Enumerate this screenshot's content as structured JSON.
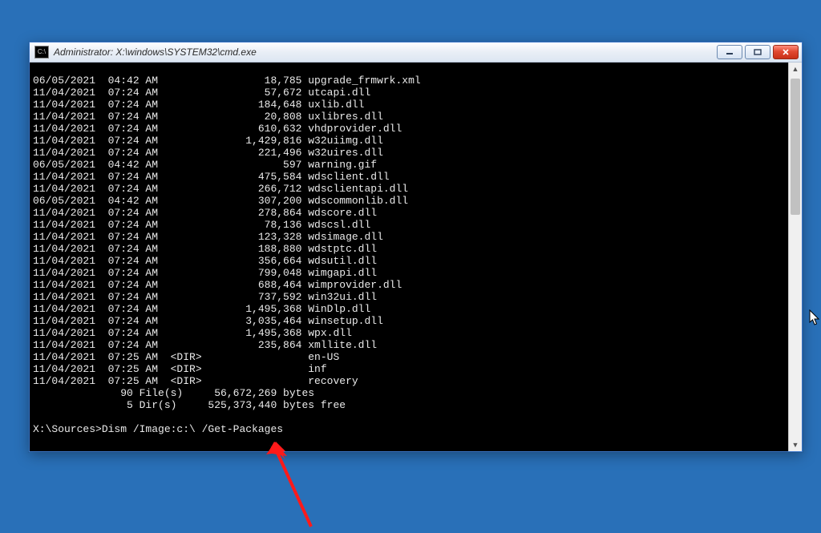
{
  "window": {
    "icon_glyph": "C:\\",
    "title": "Administrator: X:\\windows\\SYSTEM32\\cmd.exe"
  },
  "listing": [
    {
      "date": "06/05/2021",
      "time": "04:42 AM",
      "dir": "",
      "size": "18,785",
      "name": "upgrade_frmwrk.xml"
    },
    {
      "date": "11/04/2021",
      "time": "07:24 AM",
      "dir": "",
      "size": "57,672",
      "name": "utcapi.dll"
    },
    {
      "date": "11/04/2021",
      "time": "07:24 AM",
      "dir": "",
      "size": "184,648",
      "name": "uxlib.dll"
    },
    {
      "date": "11/04/2021",
      "time": "07:24 AM",
      "dir": "",
      "size": "20,808",
      "name": "uxlibres.dll"
    },
    {
      "date": "11/04/2021",
      "time": "07:24 AM",
      "dir": "",
      "size": "610,632",
      "name": "vhdprovider.dll"
    },
    {
      "date": "11/04/2021",
      "time": "07:24 AM",
      "dir": "",
      "size": "1,429,816",
      "name": "w32uiimg.dll"
    },
    {
      "date": "11/04/2021",
      "time": "07:24 AM",
      "dir": "",
      "size": "221,496",
      "name": "w32uires.dll"
    },
    {
      "date": "06/05/2021",
      "time": "04:42 AM",
      "dir": "",
      "size": "597",
      "name": "warning.gif"
    },
    {
      "date": "11/04/2021",
      "time": "07:24 AM",
      "dir": "",
      "size": "475,584",
      "name": "wdsclient.dll"
    },
    {
      "date": "11/04/2021",
      "time": "07:24 AM",
      "dir": "",
      "size": "266,712",
      "name": "wdsclientapi.dll"
    },
    {
      "date": "06/05/2021",
      "time": "04:42 AM",
      "dir": "",
      "size": "307,200",
      "name": "wdscommonlib.dll"
    },
    {
      "date": "11/04/2021",
      "time": "07:24 AM",
      "dir": "",
      "size": "278,864",
      "name": "wdscore.dll"
    },
    {
      "date": "11/04/2021",
      "time": "07:24 AM",
      "dir": "",
      "size": "78,136",
      "name": "wdscsl.dll"
    },
    {
      "date": "11/04/2021",
      "time": "07:24 AM",
      "dir": "",
      "size": "123,328",
      "name": "wdsimage.dll"
    },
    {
      "date": "11/04/2021",
      "time": "07:24 AM",
      "dir": "",
      "size": "188,880",
      "name": "wdstptc.dll"
    },
    {
      "date": "11/04/2021",
      "time": "07:24 AM",
      "dir": "",
      "size": "356,664",
      "name": "wdsutil.dll"
    },
    {
      "date": "11/04/2021",
      "time": "07:24 AM",
      "dir": "",
      "size": "799,048",
      "name": "wimgapi.dll"
    },
    {
      "date": "11/04/2021",
      "time": "07:24 AM",
      "dir": "",
      "size": "688,464",
      "name": "wimprovider.dll"
    },
    {
      "date": "11/04/2021",
      "time": "07:24 AM",
      "dir": "",
      "size": "737,592",
      "name": "win32ui.dll"
    },
    {
      "date": "11/04/2021",
      "time": "07:24 AM",
      "dir": "",
      "size": "1,495,368",
      "name": "WinDlp.dll"
    },
    {
      "date": "11/04/2021",
      "time": "07:24 AM",
      "dir": "",
      "size": "3,035,464",
      "name": "winsetup.dll"
    },
    {
      "date": "11/04/2021",
      "time": "07:24 AM",
      "dir": "",
      "size": "1,495,368",
      "name": "wpx.dll"
    },
    {
      "date": "11/04/2021",
      "time": "07:24 AM",
      "dir": "",
      "size": "235,864",
      "name": "xmllite.dll"
    },
    {
      "date": "11/04/2021",
      "time": "07:25 AM",
      "dir": "<DIR>",
      "size": "",
      "name": "en-US"
    },
    {
      "date": "11/04/2021",
      "time": "07:25 AM",
      "dir": "<DIR>",
      "size": "",
      "name": "inf"
    },
    {
      "date": "11/04/2021",
      "time": "07:25 AM",
      "dir": "<DIR>",
      "size": "",
      "name": "recovery"
    }
  ],
  "summary": {
    "files_count": "90",
    "files_label": "File(s)",
    "files_bytes": "56,672,269",
    "files_unit": "bytes",
    "dirs_count": "5",
    "dirs_label": "Dir(s)",
    "dirs_bytes": "525,373,440",
    "dirs_unit": "bytes free"
  },
  "prompt": {
    "path": "X:\\Sources>",
    "command": "Dism /Image:c:\\ /Get-Packages"
  }
}
